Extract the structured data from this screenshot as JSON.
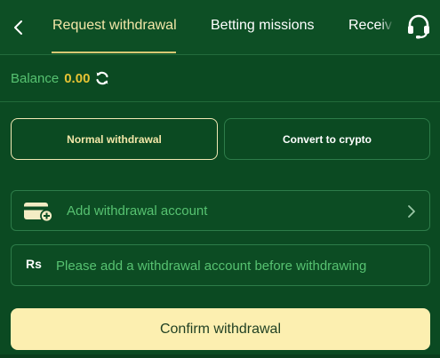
{
  "header": {
    "tabs": [
      {
        "label": "Request withdrawal",
        "active": true
      },
      {
        "label": "Betting missions",
        "active": false
      },
      {
        "label": "Receiv",
        "active": false
      }
    ],
    "back_icon": "chevron-left-icon",
    "support_icon": "headset-icon"
  },
  "balance": {
    "label": "Balance",
    "value": "0.00",
    "refresh_icon": "refresh-icon"
  },
  "withdrawal_modes": [
    {
      "label": "Normal withdrawal",
      "selected": true
    },
    {
      "label": "Convert to crypto",
      "selected": false
    }
  ],
  "account_row": {
    "label": "Add withdrawal account",
    "icon": "card-add-icon"
  },
  "amount_row": {
    "currency_symbol": "Rs",
    "placeholder": "Please add a withdrawal account before withdrawing"
  },
  "confirm_label": "Confirm withdrawal",
  "colors": {
    "background": "#0b4a22",
    "accent_gold": "#e6c334",
    "accent_green": "#57c271",
    "confirm_bg": "#fcefb0",
    "border": "#2d7c49"
  }
}
